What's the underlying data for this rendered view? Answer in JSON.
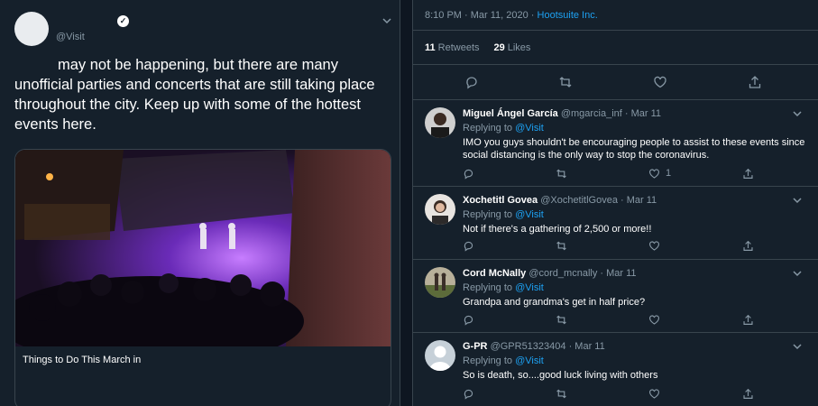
{
  "tweet": {
    "handle": "@Visit",
    "text": "may not be happening, but there are many unofficial parties and concerts that are still taking place throughout the city. Keep up with some of the hottest events here.",
    "card_title": "Things to Do This March in"
  },
  "detail": {
    "timestamp": "8:10 PM · Mar 11, 2020 · ",
    "source": "Hootsuite Inc.",
    "retweets_count": "11",
    "retweets_label": "Retweets",
    "likes_count": "29",
    "likes_label": "Likes"
  },
  "replies": [
    {
      "name": "Miguel Ángel García",
      "handle": "@mgarcia_inf",
      "date": "· Mar 11",
      "replying_label": "Replying to ",
      "replying_to": "@Visit",
      "text": "IMO you guys shouldn't be encouraging people to assist to these events since social distancing is the only way to stop the coronavirus.",
      "like_count": "1"
    },
    {
      "name": "Xochetitl Govea",
      "handle": "@XochetitlGovea",
      "date": "· Mar 11",
      "replying_label": "Replying to ",
      "replying_to": "@Visit",
      "text": "Not if there's a gathering of 2,500 or more!!",
      "like_count": ""
    },
    {
      "name": "Cord McNally",
      "handle": "@cord_mcnally",
      "date": "· Mar 11",
      "replying_label": "Replying to ",
      "replying_to": "@Visit",
      "text": "Grandpa and grandma's get in half price?",
      "like_count": ""
    },
    {
      "name": "G-PR",
      "handle": "@GPR51323404",
      "date": "· Mar 11",
      "replying_label": "Replying to ",
      "replying_to": "@Visit",
      "text": "So is death, so....good luck living with others",
      "like_count": ""
    }
  ],
  "colors": {
    "background": "#15202b",
    "border": "#38444d",
    "secondary_text": "#8899a6",
    "accent": "#1da1f2"
  }
}
